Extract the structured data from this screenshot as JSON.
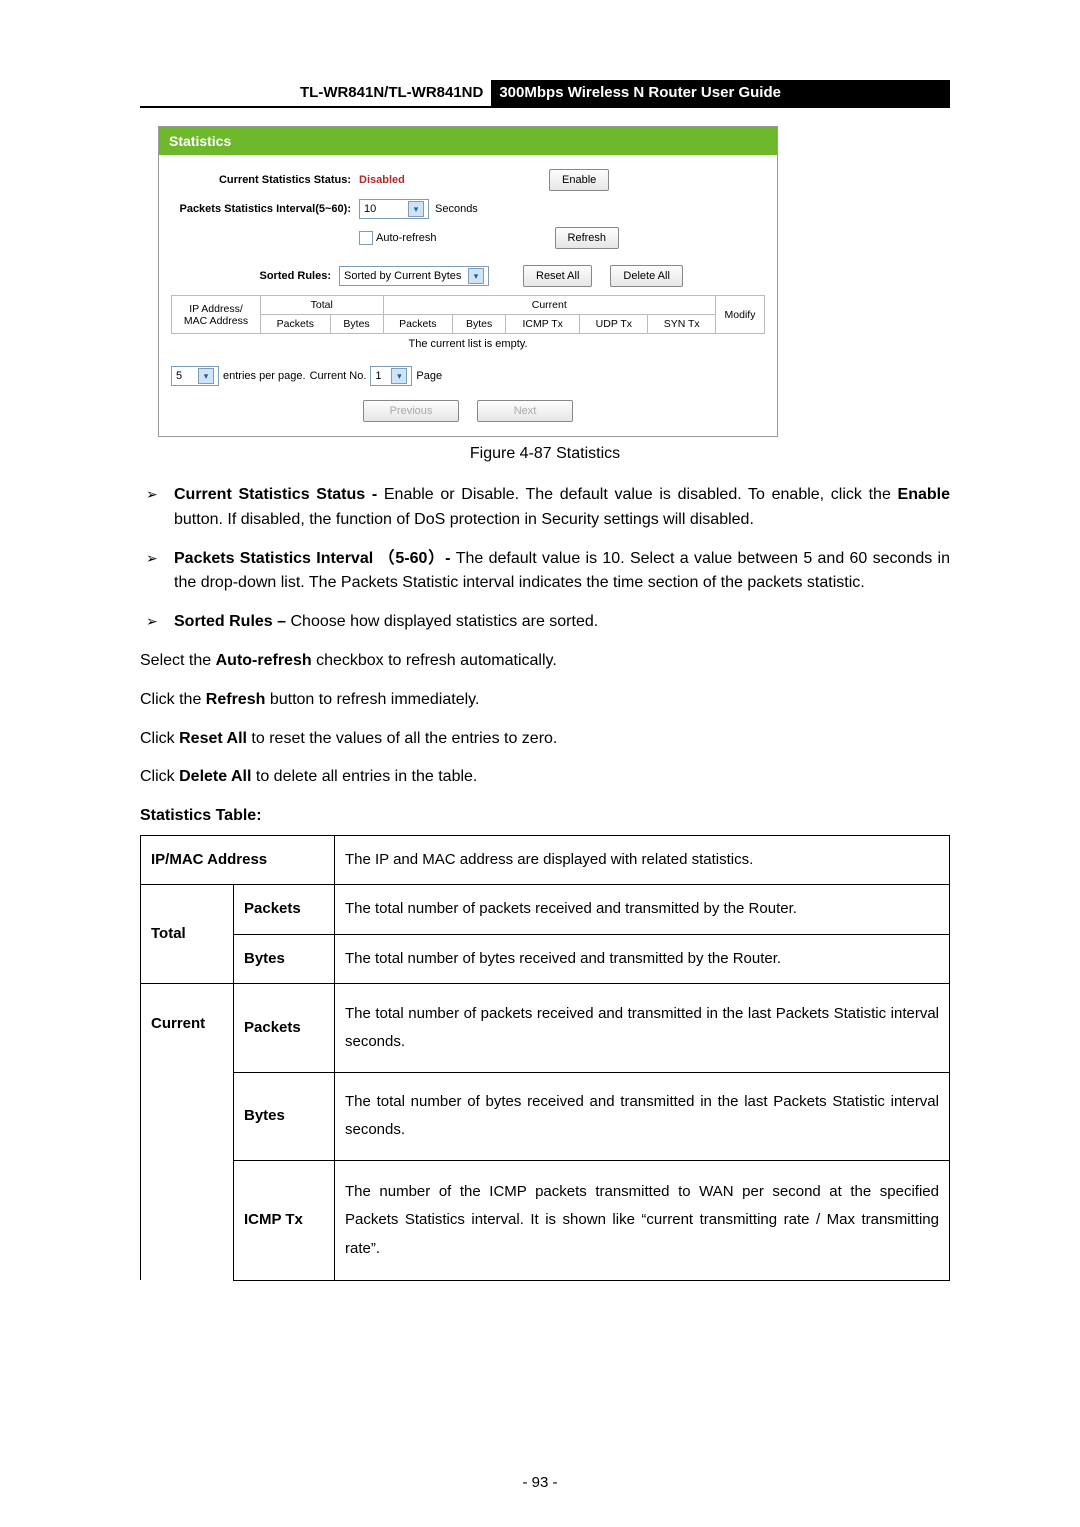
{
  "header": {
    "model": "TL-WR841N/TL-WR841ND",
    "title": "300Mbps Wireless N Router User Guide"
  },
  "screenshot": {
    "panel_title": "Statistics",
    "status_label": "Current Statistics Status:",
    "status_value": "Disabled",
    "enable_btn": "Enable",
    "interval_label": "Packets Statistics Interval(5~60):",
    "interval_value": "10",
    "interval_unit": "Seconds",
    "autorefresh_label": "Auto-refresh",
    "refresh_btn": "Refresh",
    "sorted_label": "Sorted Rules:",
    "sorted_value": "Sorted by Current Bytes",
    "reset_btn": "Reset All",
    "delete_btn": "Delete All",
    "th": {
      "addr": "IP Address/\nMAC Address",
      "total": "Total",
      "current": "Current",
      "modify": "Modify",
      "packets": "Packets",
      "bytes": "Bytes",
      "icmp": "ICMP Tx",
      "udp": "UDP Tx",
      "syn": "SYN Tx"
    },
    "empty_row": "The current list is empty.",
    "pager": {
      "entries_value": "5",
      "entries_text": "entries per page.",
      "current_text": "Current No.",
      "page_value": "1",
      "page_text": "Page"
    },
    "prev_btn": "Previous",
    "next_btn": "Next"
  },
  "figure_caption": "Figure 4-87    Statistics",
  "bullets": {
    "b1_bold": "Current Statistics Status - ",
    "b1_rest": "Enable or Disable. The default value is disabled. To enable, click the ",
    "b1_bold2": "Enable",
    "b1_rest2": " button. If disabled, the function of DoS protection in Security settings will disabled.",
    "b2_bold": "Packets Statistics Interval （5-60）- ",
    "b2_rest": "The default value is 10. Select a value between 5 and 60 seconds in the drop-down list. The Packets Statistic interval indicates the time section of the packets statistic.",
    "b3_bold": "Sorted Rules – ",
    "b3_rest": "Choose how displayed statistics are sorted."
  },
  "paras": {
    "p1a": "Select the ",
    "p1b": "Auto-refresh",
    "p1c": " checkbox to refresh automatically.",
    "p2a": "Click the ",
    "p2b": "Refresh",
    "p2c": " button to refresh immediately.",
    "p3a": "Click ",
    "p3b": "Reset All",
    "p3c": " to reset the values of all the entries to zero.",
    "p4a": "Click ",
    "p4b": "Delete All",
    "p4c": " to delete all entries in the table."
  },
  "stat_heading": "Statistics Table:",
  "table": {
    "r1_k": "IP/MAC Address",
    "r1_v": "The IP and MAC address are displayed with related statistics.",
    "total": "Total",
    "current": "Current",
    "packets": "Packets",
    "bytes": "Bytes",
    "icmp": "ICMP Tx",
    "total_packets": "The total number of packets received and transmitted by the Router.",
    "total_bytes": "The total number of bytes received and transmitted by the Router.",
    "cur_packets": "The total number of packets received and transmitted in the last Packets Statistic interval seconds.",
    "cur_bytes": "The total number of bytes received and transmitted in the last Packets Statistic interval seconds.",
    "cur_icmp": "The number of the ICMP packets transmitted to WAN per second at the specified Packets Statistics interval. It is shown like “current transmitting rate / Max transmitting rate”."
  },
  "page_number": "- 93 -"
}
